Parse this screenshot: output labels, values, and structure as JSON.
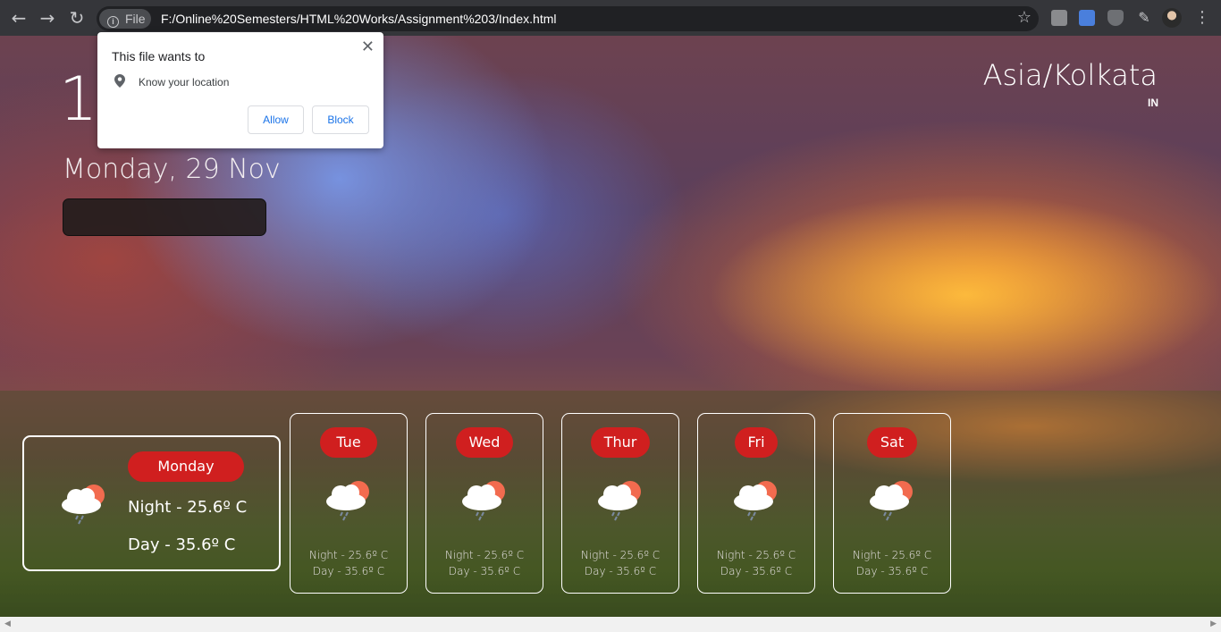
{
  "browser": {
    "file_label": "File",
    "url": "F:/Online%20Semesters/HTML%20Works/Assignment%203/Index.html"
  },
  "page": {
    "time_partial": "12",
    "date": "Monday, 29 Nov",
    "timezone": "Asia/Kolkata",
    "country": "IN"
  },
  "permission_popup": {
    "title": "This file wants to",
    "permission": "Know your location",
    "allow_label": "Allow",
    "block_label": "Block"
  },
  "forecast": {
    "today": {
      "day": "Monday",
      "night": "Night - 25.6º C",
      "day_temp": "Day - 35.6º C"
    },
    "days": [
      {
        "day": "Tue",
        "night": "Night - 25.6º C",
        "day_temp": "Day - 35.6º C"
      },
      {
        "day": "Wed",
        "night": "Night - 25.6º C",
        "day_temp": "Day - 35.6º C"
      },
      {
        "day": "Thur",
        "night": "Night - 25.6º C",
        "day_temp": "Day - 35.6º C"
      },
      {
        "day": "Fri",
        "night": "Night - 25.6º C",
        "day_temp": "Day - 35.6º C"
      },
      {
        "day": "Sat",
        "night": "Night - 25.6º C",
        "day_temp": "Day - 35.6º C"
      }
    ],
    "icon": "cloud-sun-rain-icon"
  },
  "colors": {
    "pill": "#d01f1f",
    "toolbar": "#35363a"
  }
}
